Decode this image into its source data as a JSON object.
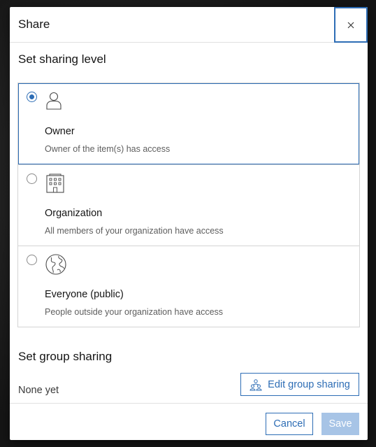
{
  "dialog": {
    "title": "Share",
    "close_label": "×"
  },
  "sharing_level": {
    "title": "Set sharing level",
    "options": [
      {
        "label": "Owner",
        "description": "Owner of the item(s) has access",
        "icon": "person-icon",
        "selected": true
      },
      {
        "label": "Organization",
        "description": "All members of your organization have access",
        "icon": "building-icon",
        "selected": false
      },
      {
        "label": "Everyone (public)",
        "description": "People outside your organization have access",
        "icon": "globe-icon",
        "selected": false
      }
    ]
  },
  "group_sharing": {
    "title": "Set group sharing",
    "status": "None yet",
    "edit_label": "Edit group sharing",
    "edit_icon": "group-icon"
  },
  "footer": {
    "cancel_label": "Cancel",
    "save_label": "Save"
  },
  "colors": {
    "accent": "#2d6db5",
    "save_disabled": "#a7c4e6"
  }
}
